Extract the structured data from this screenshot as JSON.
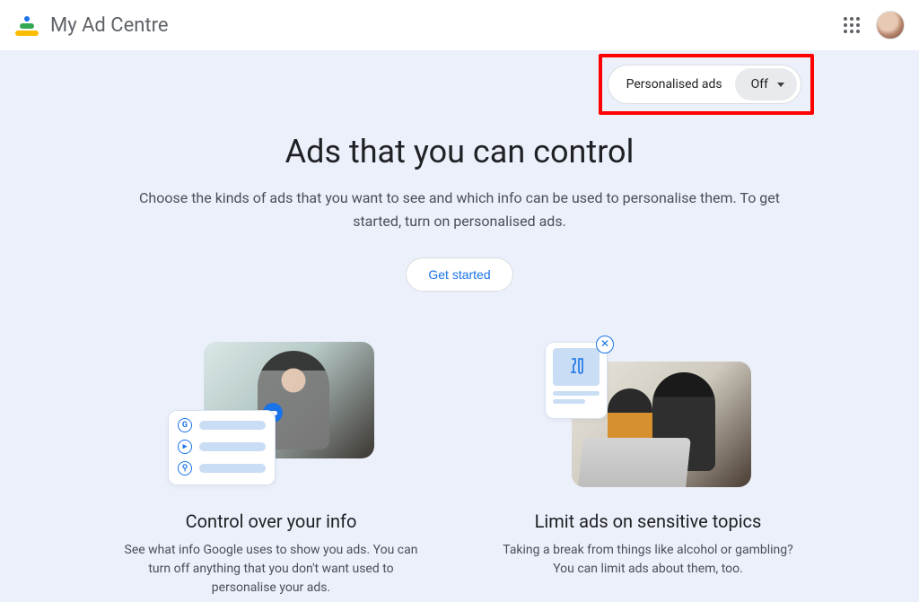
{
  "header": {
    "app_title": "My Ad Centre"
  },
  "personalised_ads": {
    "label": "Personalised ads",
    "value": "Off"
  },
  "hero": {
    "title": "Ads that you can control",
    "subtitle": "Choose the kinds of ads that you want to see and which info can be used to personalise them. To get started, turn on personalised ads.",
    "cta": "Get started"
  },
  "features": [
    {
      "title": "Control over your info",
      "desc": "See what info Google uses to show you ads. You can turn off anything that you don't want used to personalise your ads."
    },
    {
      "title": "Limit ads on sensitive topics",
      "desc": "Taking a break from things like alcohol or gambling? You can limit ads about them, too."
    }
  ]
}
